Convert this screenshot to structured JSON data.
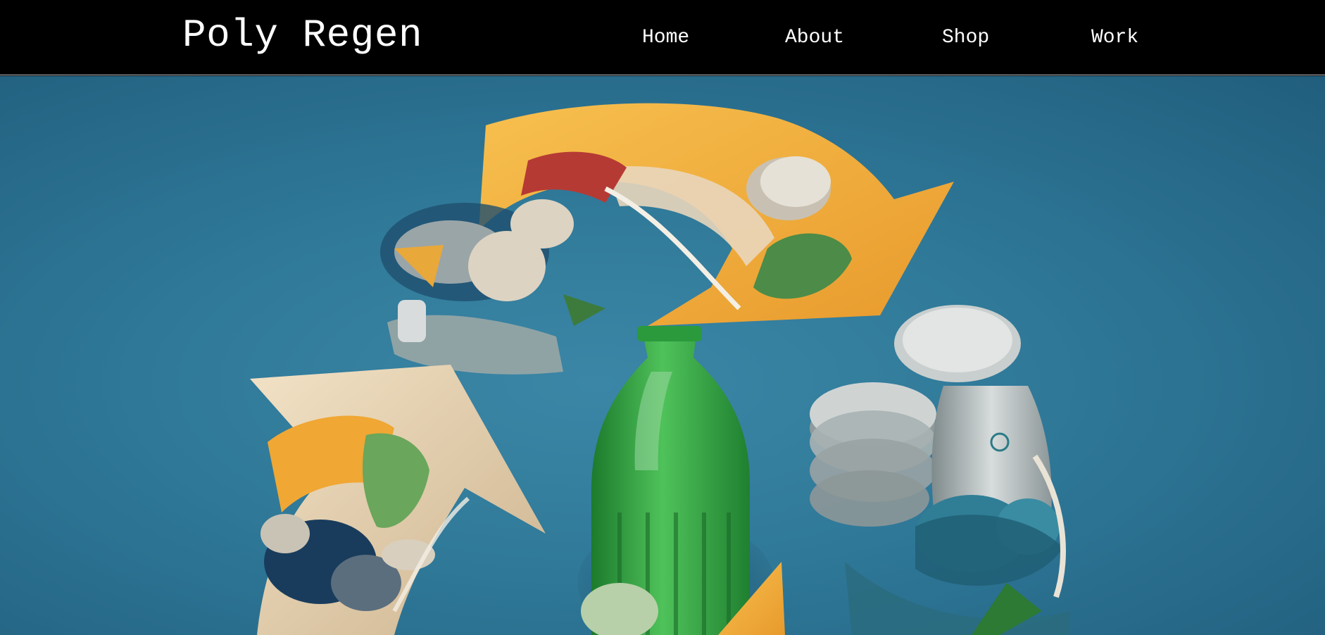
{
  "header": {
    "brand": "Poly Regen",
    "nav": [
      {
        "label": "Home"
      },
      {
        "label": "About"
      },
      {
        "label": "Shop"
      },
      {
        "label": "Work"
      }
    ]
  },
  "hero": {
    "image_icon": "recycling-symbol-made-of-plastic-waste",
    "colors": {
      "background": "#2f7898",
      "arrow_orange": "#f2ad3c",
      "arrow_cream": "#e8d3b3",
      "bottle_green": "#2fa043",
      "metal": "#b9bfbf"
    }
  }
}
